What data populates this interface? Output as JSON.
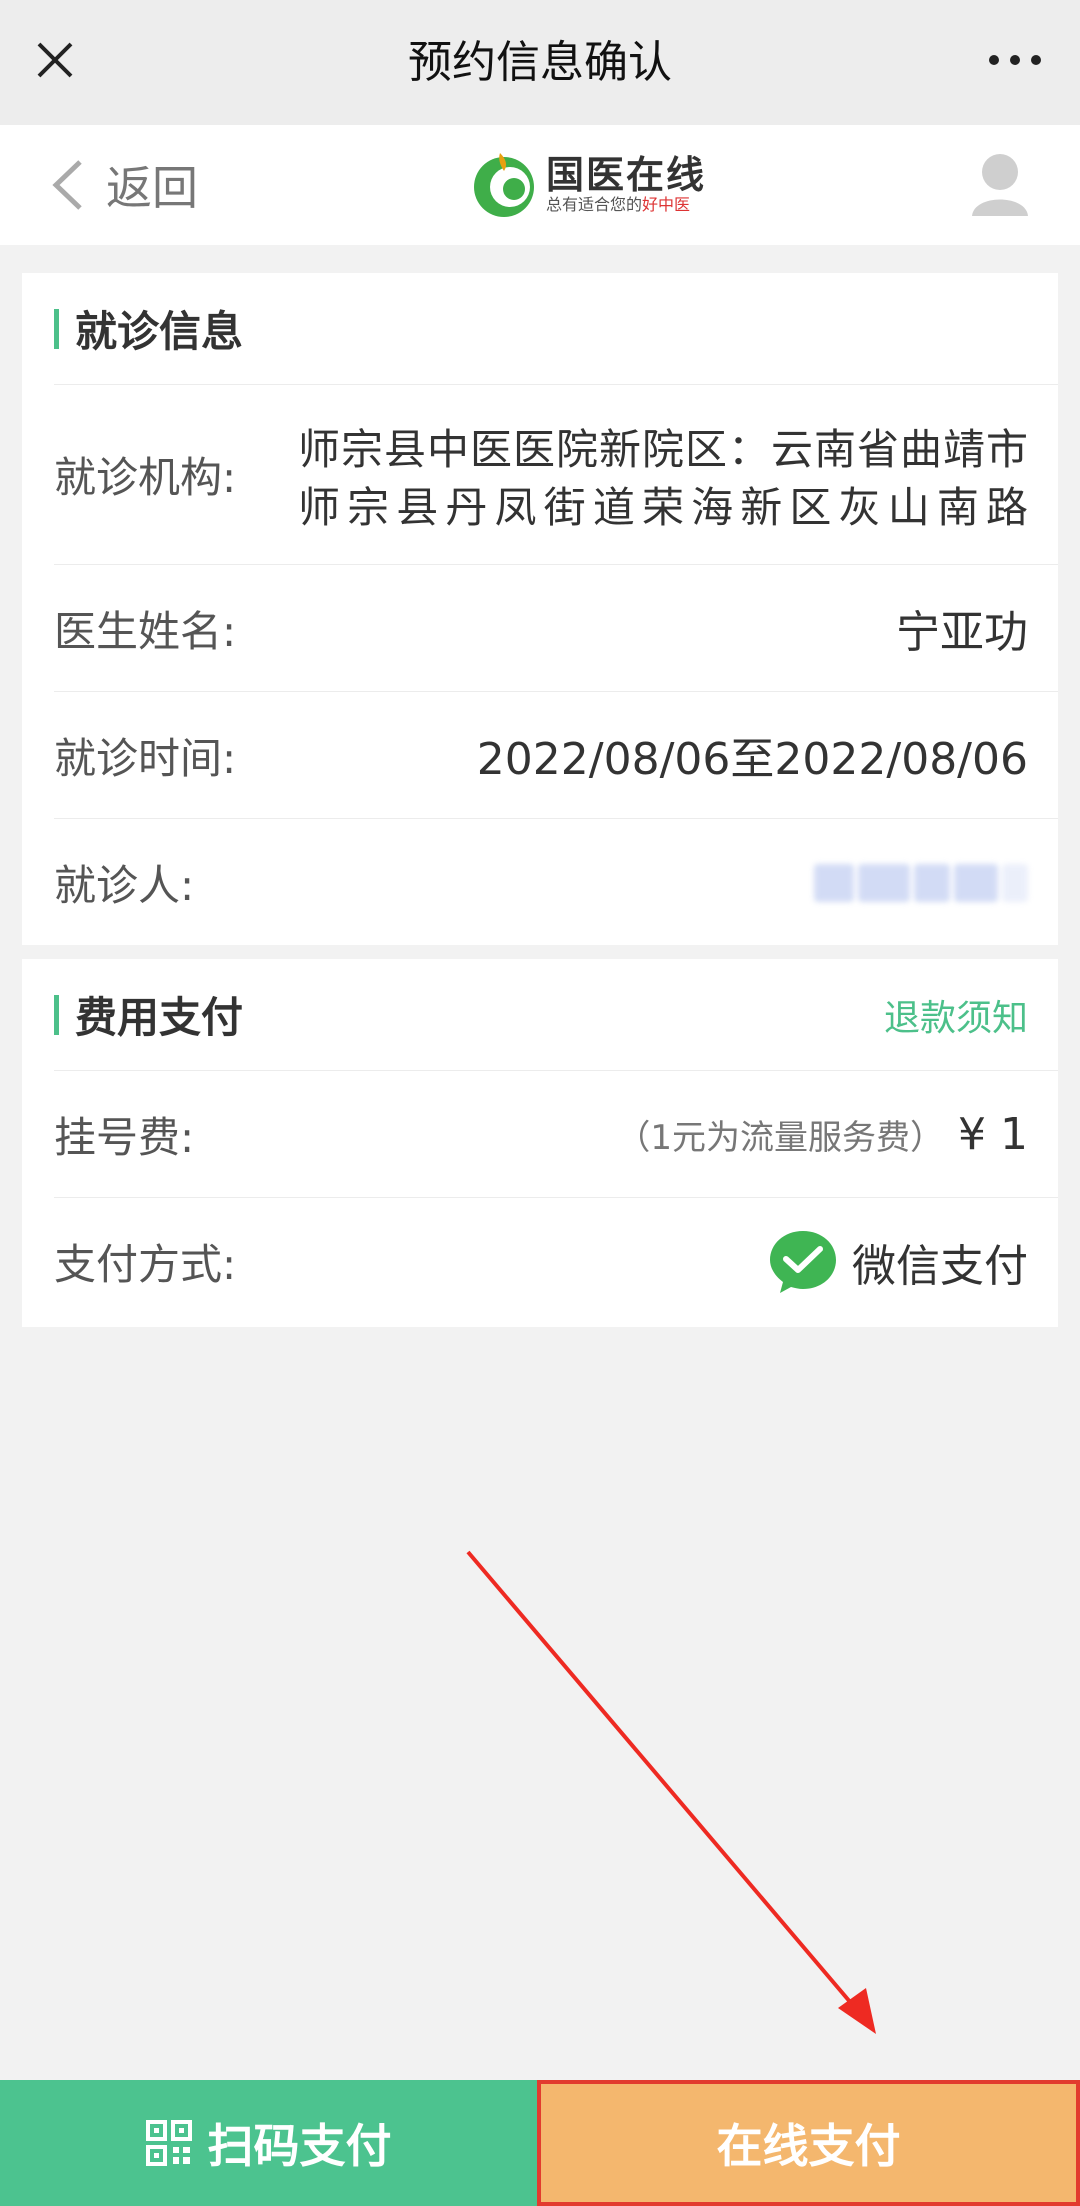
{
  "titlebar": {
    "title": "预约信息确认"
  },
  "subheader": {
    "back_label": "返回",
    "logo_text": "国医在线",
    "slogan_prefix": "总有适合您的",
    "slogan_highlight": "好中医"
  },
  "visit": {
    "section_title": "就诊信息",
    "rows": [
      {
        "key": "就诊机构:",
        "value": "师宗县中医医院新院区：云南省曲靖市师宗县丹凤街道荣海新区灰山南路"
      },
      {
        "key": "医生姓名:",
        "value": "宁亚功"
      },
      {
        "key": "就诊时间:",
        "value": "2022/08/06至2022/08/06"
      },
      {
        "key": "就诊人:",
        "value": ""
      }
    ]
  },
  "payment": {
    "section_title": "费用支付",
    "refund_link": "退款须知",
    "fee_key": "挂号费:",
    "fee_note": "（1元为流量服务费）",
    "fee_amount": "¥ 1",
    "method_key": "支付方式:",
    "method_value": "微信支付"
  },
  "buttons": {
    "scan_pay": "扫码支付",
    "online_pay": "在线支付"
  },
  "colors": {
    "accent_green": "#4cc08a",
    "scan_button": "#4cc38f",
    "online_button": "#f4b76e",
    "highlight_red": "#e23b2e"
  }
}
